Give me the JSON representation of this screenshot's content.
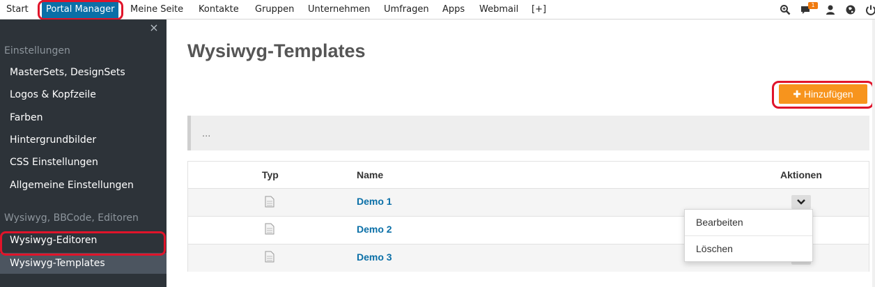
{
  "nav": {
    "items": [
      "Start",
      "Portal Manager",
      "Meine Seite",
      "Kontakte",
      "Gruppen",
      "Unternehmen",
      "Umfragen",
      "Apps",
      "Webmail",
      "[+]"
    ],
    "active_index": 1,
    "notification_count": "1",
    "icons": [
      "search-zoom-icon",
      "chat-icon",
      "user-icon",
      "globe-icon",
      "power-icon"
    ]
  },
  "sidebar": {
    "close_glyph": "×",
    "section1": "Einstellungen",
    "items1": [
      "MasterSets, DesignSets",
      "Logos & Kopfzeile",
      "Farben",
      "Hintergrundbilder",
      "CSS Einstellungen",
      "Allgemeine Einstellungen"
    ],
    "section2": "Wysiwyg, BBCode, Editoren",
    "items2": [
      "Wysiwyg-Editoren",
      "Wysiwyg-Templates"
    ],
    "active_item": "Wysiwyg-Templates"
  },
  "main": {
    "title": "Wysiwyg-Templates",
    "add_button": "Hinzufügen",
    "filter_text": "...",
    "table": {
      "headers": [
        "Typ",
        "Name",
        "Aktionen"
      ],
      "rows": [
        {
          "name": "Demo 1"
        },
        {
          "name": "Demo 2"
        },
        {
          "name": "Demo 3"
        }
      ]
    },
    "dropdown": [
      "Bearbeiten",
      "Löschen"
    ]
  },
  "colors": {
    "accent": "#0a6fa7",
    "button": "#f7941d",
    "sidebar": "#2d3339",
    "highlight": "#e0142a"
  }
}
